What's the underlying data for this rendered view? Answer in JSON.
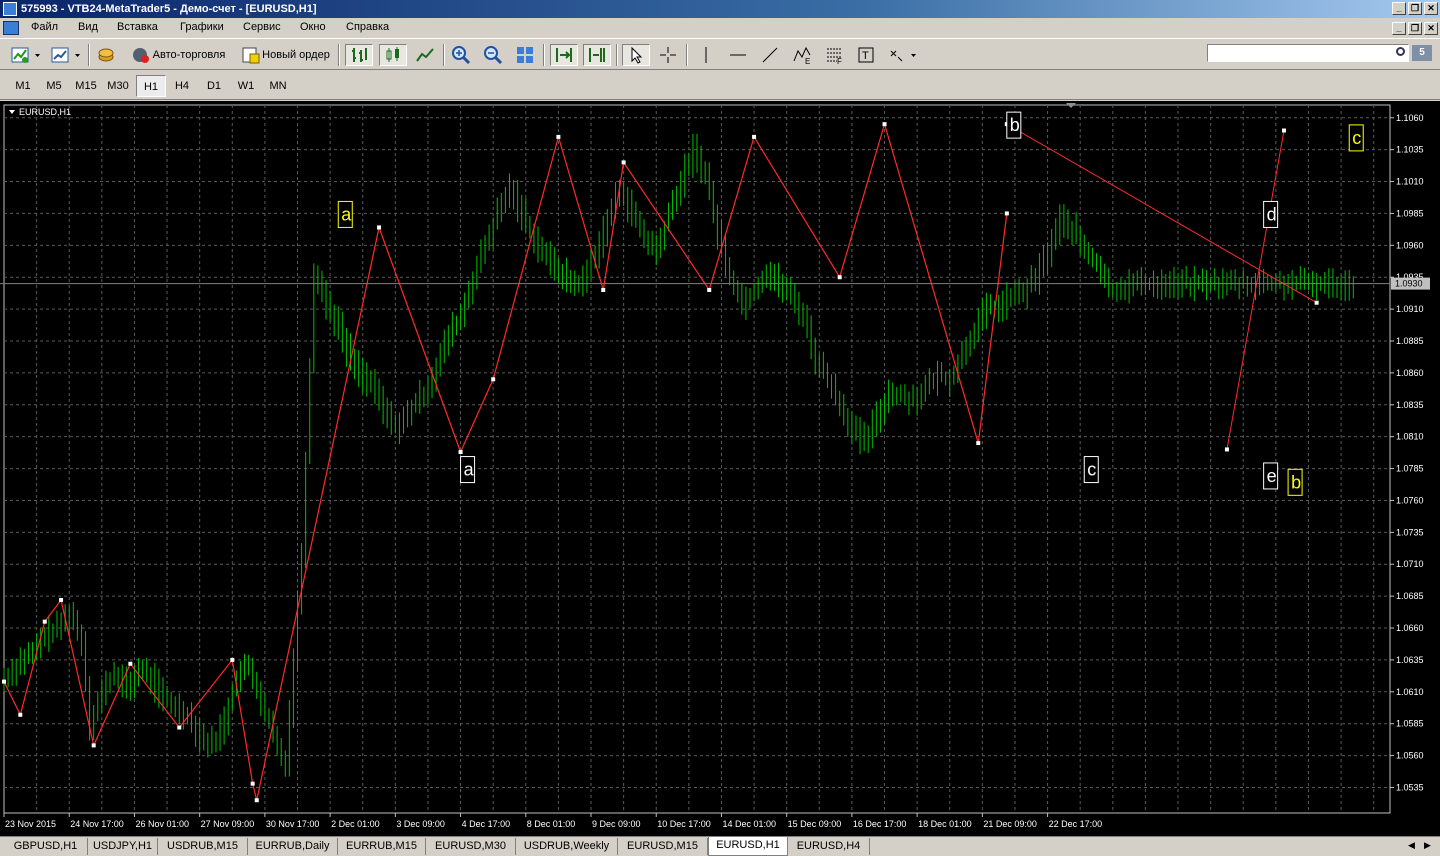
{
  "window": {
    "title": "575993 - VTB24-MetaTrader5 - Демо-счет - [EURUSD,H1]"
  },
  "menu": [
    "Файл",
    "Вид",
    "Вставка",
    "Графики",
    "Сервис",
    "Окно",
    "Справка"
  ],
  "toolbar": {
    "autotrade_label": "Авто-торговля",
    "neworder_label": "Новый ордер",
    "search_value": "",
    "badge": "5"
  },
  "timeframes": [
    "M1",
    "M5",
    "M15",
    "M30",
    "H1",
    "H4",
    "D1",
    "W1",
    "MN"
  ],
  "active_timeframe": "H1",
  "chart_label": "EURUSD,H1",
  "tabs": [
    "GBPUSD,H1",
    "USDJPY,H1",
    "USDRUB,M15",
    "EURRUB,Daily",
    "EURRUB,M15",
    "EURUSD,M30",
    "USDRUB,Weekly",
    "EURUSD,M15",
    "EURUSD,H1",
    "EURUSD,H4"
  ],
  "active_tab": "EURUSD,H1",
  "colors": {
    "background": "#000000",
    "candles": "#00c000",
    "zigzag": "#ff2a2a",
    "grid": "#5a5a5a",
    "label_yellow": "#ffff00"
  },
  "chart_data": {
    "type": "line",
    "symbol": "EURUSD",
    "timeframe": "H1",
    "current_price": "1.0930",
    "ylim": [
      1.0515,
      1.107
    ],
    "y_ticks": [
      "1.1060",
      "1.1035",
      "1.1010",
      "1.0985",
      "1.0960",
      "1.0935",
      "1.0910",
      "1.0885",
      "1.0860",
      "1.0835",
      "1.0810",
      "1.0785",
      "1.0760",
      "1.0735",
      "1.0710",
      "1.0685",
      "1.0660",
      "1.0635",
      "1.0610",
      "1.0585",
      "1.0560",
      "1.0535"
    ],
    "x_ticks": [
      "23 Nov 2015",
      "24 Nov 17:00",
      "26 Nov 01:00",
      "27 Nov 09:00",
      "30 Nov 17:00",
      "2 Dec 01:00",
      "3 Dec 09:00",
      "4 Dec 17:00",
      "8 Dec 01:00",
      "9 Dec 09:00",
      "10 Dec 17:00",
      "14 Dec 01:00",
      "15 Dec 09:00",
      "16 Dec 17:00",
      "18 Dec 01:00",
      "21 Dec 09:00",
      "22 Dec 17:00"
    ],
    "price_series": {
      "name": "EURUSD,H1",
      "x_index": [
        0,
        4,
        7,
        10,
        13,
        16,
        19,
        21,
        24,
        27,
        30,
        33,
        36,
        39,
        42,
        45,
        48,
        51,
        54,
        57,
        60,
        62,
        63,
        65,
        67,
        69,
        70,
        73,
        76,
        79,
        82,
        85,
        88,
        91,
        94,
        97,
        100,
        103,
        106,
        109,
        112,
        115,
        118,
        121,
        124,
        127,
        130,
        133,
        136,
        139,
        142,
        145,
        148,
        151,
        154,
        157,
        160,
        163,
        166,
        169,
        172,
        175,
        178,
        181,
        184,
        187,
        190,
        193,
        196,
        199,
        202,
        205,
        208,
        211,
        214,
        217,
        220,
        223,
        226,
        229,
        232,
        235,
        238,
        241,
        244,
        247,
        250,
        253,
        256,
        259,
        262,
        265,
        268,
        271,
        274,
        277,
        280,
        283,
        286,
        289,
        292,
        295,
        298,
        301,
        304,
        307,
        310,
        313,
        316,
        319,
        322,
        325,
        328,
        331
      ],
      "y": [
        1.062,
        1.0635,
        1.064,
        1.0655,
        1.066,
        1.0672,
        1.065,
        1.0585,
        1.061,
        1.0625,
        1.0612,
        1.0628,
        1.062,
        1.0605,
        1.0598,
        1.0592,
        1.0575,
        1.0568,
        1.0588,
        1.0622,
        1.063,
        1.0612,
        1.0598,
        1.0585,
        1.0565,
        1.0555,
        1.0595,
        1.072,
        1.094,
        1.0915,
        1.0895,
        1.087,
        1.0858,
        1.0845,
        1.0825,
        1.0818,
        1.0833,
        1.0845,
        1.0865,
        1.089,
        1.0905,
        1.0935,
        1.096,
        1.0985,
        1.1005,
        1.0985,
        1.0965,
        1.095,
        1.094,
        1.093,
        1.0932,
        1.0955,
        1.098,
        1.1005,
        1.0985,
        1.0965,
        1.0955,
        1.0985,
        1.101,
        1.1035,
        1.1015,
        1.097,
        1.0935,
        1.0915,
        1.0925,
        1.094,
        1.093,
        1.092,
        1.0905,
        1.087,
        1.0855,
        1.0835,
        1.0815,
        1.0805,
        1.0825,
        1.0845,
        1.0842,
        1.084,
        1.0848,
        1.0858,
        1.0855,
        1.0875,
        1.0895,
        1.091,
        1.0912,
        1.092,
        1.0923,
        1.0935,
        1.0955,
        1.098,
        1.0972,
        1.0955,
        1.0945,
        1.0925,
        1.0927,
        1.093,
        1.093,
        1.093,
        1.093,
        1.093,
        1.093,
        1.093,
        1.093,
        1.093,
        1.093,
        1.093,
        1.093,
        1.093,
        1.093,
        1.093,
        1.093,
        1.093,
        1.093,
        1.093
      ]
    },
    "zigzag": {
      "x_index": [
        0,
        4,
        10,
        14,
        22,
        31,
        43,
        56,
        61,
        62,
        92,
        112,
        120,
        136,
        147,
        152,
        173,
        184,
        205,
        216,
        239,
        246
      ],
      "y": [
        1.0618,
        1.0592,
        1.0665,
        1.0682,
        1.0568,
        1.0632,
        1.0582,
        1.0635,
        1.0538,
        1.0525,
        1.0974,
        1.0798,
        1.0855,
        1.1045,
        1.0925,
        1.1025,
        1.0925,
        1.1045,
        1.0935,
        1.1055,
        1.0805,
        1.0985
      ]
    },
    "wave_lines": [
      {
        "x_index": [
          246,
          322
        ],
        "y": [
          1.1055,
          1.0915
        ]
      },
      {
        "x_index": [
          300,
          314
        ],
        "y": [
          1.08,
          1.105
        ]
      }
    ],
    "wave_labels": [
      {
        "text": "a",
        "color": "#ffff00",
        "x_index": 82,
        "y": 1.0985
      },
      {
        "text": "a",
        "color": "#ffffff",
        "x_index": 112,
        "y": 1.0785
      },
      {
        "text": "b",
        "color": "#ffffff",
        "x_index": 246,
        "y": 1.1055
      },
      {
        "text": "c",
        "color": "#ffffff",
        "x_index": 265,
        "y": 1.0785
      },
      {
        "text": "d",
        "color": "#ffffff",
        "x_index": 309,
        "y": 1.0985
      },
      {
        "text": "e",
        "color": "#ffffff",
        "x_index": 309,
        "y": 1.078
      },
      {
        "text": "b",
        "color": "#ffff00",
        "x_index": 315,
        "y": 1.0775
      },
      {
        "text": "c",
        "color": "#ffff00",
        "x_index": 330,
        "y": 1.1045
      }
    ]
  }
}
